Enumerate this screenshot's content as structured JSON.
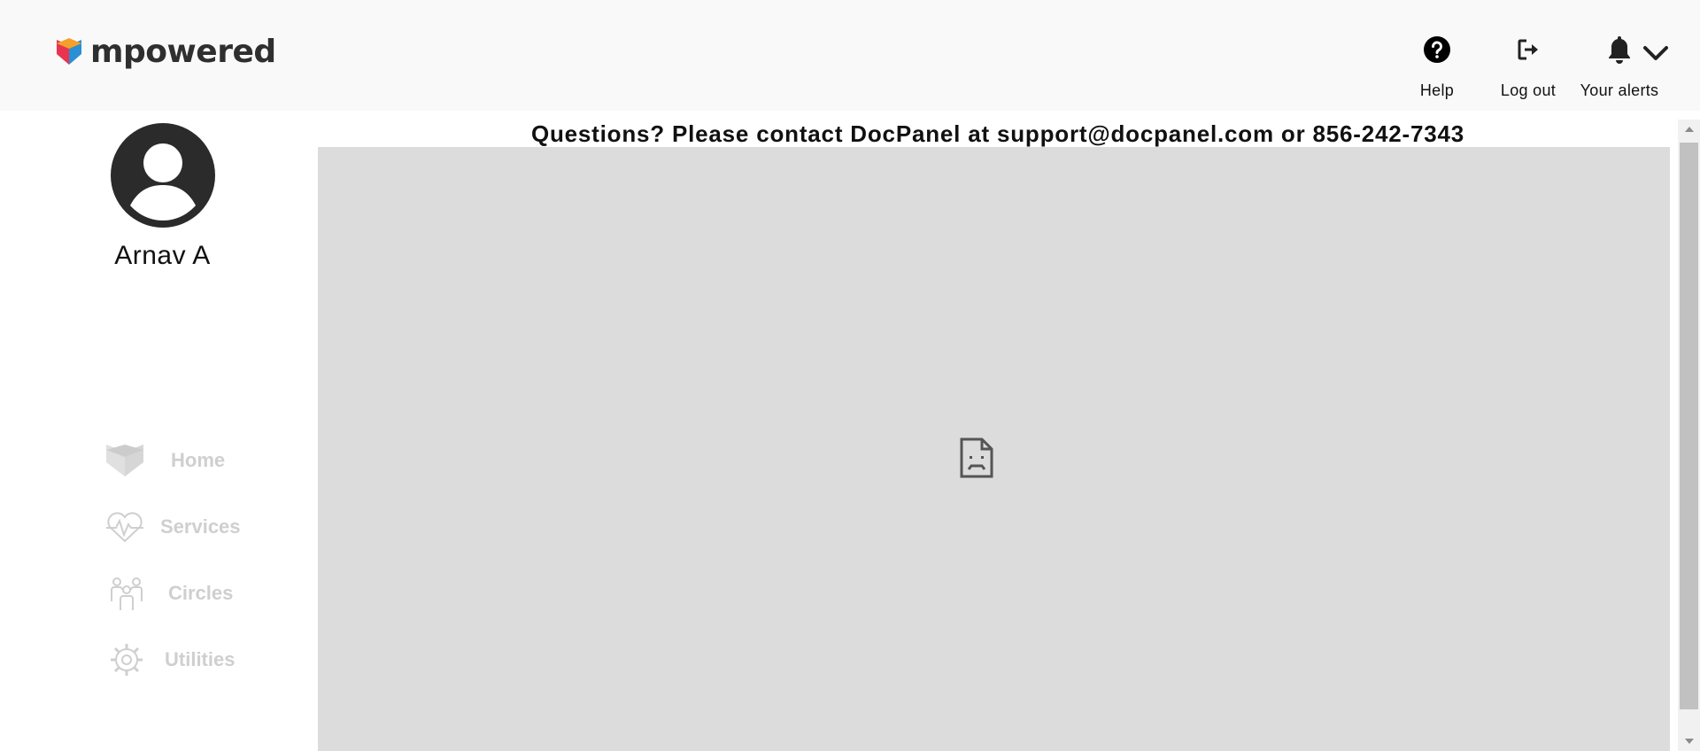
{
  "brand": {
    "name": "mpowered",
    "logo_icon": "heart-cube-logo-icon",
    "colors": {
      "red": "#e8344e",
      "orange": "#f5a02a",
      "blue": "#2a8fd4",
      "dark": "#2f2f2f"
    }
  },
  "header": {
    "actions": [
      {
        "label": "Help",
        "icon": "help-circle-icon"
      },
      {
        "label": "Log out",
        "icon": "logout-icon"
      },
      {
        "label": "Your alerts",
        "icon": "bell-icon"
      }
    ],
    "menu_toggle_icon": "chevron-down-icon"
  },
  "user": {
    "name": "Arnav A",
    "avatar_icon": "user-avatar-icon"
  },
  "sidebar": {
    "items": [
      {
        "label": "Home",
        "icon": "home-heart-icon"
      },
      {
        "label": "Services",
        "icon": "heartbeat-icon"
      },
      {
        "label": "Circles",
        "icon": "people-group-icon"
      },
      {
        "label": "Utilities",
        "icon": "gear-wrench-icon"
      }
    ],
    "inactive_color": "#cfcfcf"
  },
  "main": {
    "contact_text": "Questions? Please contact DocPanel at support@docpanel.com or 856-242-7343",
    "frame_state_icon": "broken-document-icon",
    "frame_bg": "#dcdcdc"
  }
}
